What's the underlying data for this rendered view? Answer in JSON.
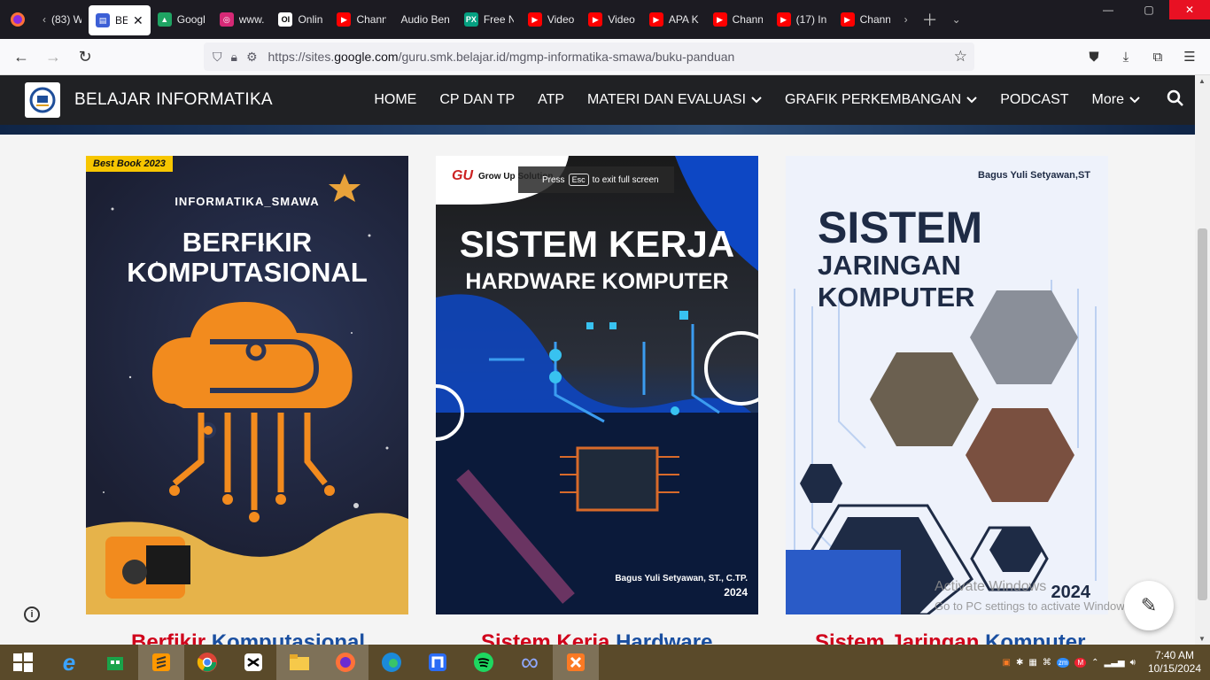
{
  "tabs": [
    {
      "label": "(83) W",
      "icon": "back-chevron-icon",
      "color": "#1c1b22"
    },
    {
      "label": "BEL",
      "icon": "google-sites-icon",
      "color": "#3c5fd6",
      "active": true
    },
    {
      "label": "Googl",
      "icon": "google-drive-icon",
      "color": "#f4b400"
    },
    {
      "label": "www.",
      "icon": "instagram-icon",
      "color": "#d62976"
    },
    {
      "label": "Onlin",
      "icon": "online-icon",
      "color": "#ffffff"
    },
    {
      "label": "Chann",
      "icon": "youtube-icon",
      "color": "#ff0000"
    },
    {
      "label": "Audio Ben",
      "icon": "none",
      "color": "#1c1b22"
    },
    {
      "label": "Free N",
      "icon": "pexels-icon",
      "color": "#05a081"
    },
    {
      "label": "Video",
      "icon": "youtube-icon",
      "color": "#ff0000"
    },
    {
      "label": "Video",
      "icon": "youtube-icon",
      "color": "#ff0000"
    },
    {
      "label": "APA K",
      "icon": "youtube-icon",
      "color": "#ff0000"
    },
    {
      "label": "Chann",
      "icon": "youtube-icon",
      "color": "#ff0000"
    },
    {
      "label": "(17) In",
      "icon": "youtube-icon",
      "color": "#ff0000"
    },
    {
      "label": "Chann",
      "icon": "youtube-icon",
      "color": "#ff0000"
    }
  ],
  "url": {
    "prefix": "https://sites.",
    "host": "google.com",
    "path": "/guru.smk.belajar.id/mgmp-informatika-smawa/buku-panduan"
  },
  "site": {
    "title": "BELAJAR INFORMATIKA",
    "menu": [
      {
        "label": "HOME",
        "dropdown": false
      },
      {
        "label": "CP DAN TP",
        "dropdown": false
      },
      {
        "label": "ATP",
        "dropdown": false
      },
      {
        "label": "MATERI DAN EVALUASI",
        "dropdown": true
      },
      {
        "label": "GRAFIK PERKEMBANGAN",
        "dropdown": true
      },
      {
        "label": "PODCAST",
        "dropdown": false
      },
      {
        "label": "More",
        "dropdown": true
      }
    ]
  },
  "books": [
    {
      "badge": "Best Book 2023",
      "author_top": "INFORMATIKA_SMAWA",
      "title_line1": "BERFIKIR",
      "title_line2": "KOMPUTASIONAL",
      "caption_red": "Berfikir",
      "caption_blue": "Komputasional"
    },
    {
      "publisher": "Grow Up Solution",
      "publisher_short": "GU",
      "title_line1": "SISTEM KERJA",
      "title_line2": "HARDWARE  KOMPUTER",
      "author_bottom": "Bagus Yuli Setyawan, ST., C.TP.",
      "year": "2024",
      "caption_red": "Sistem Kerja",
      "caption_blue": "Hardware"
    },
    {
      "author_top": "Bagus Yuli Setyawan,ST",
      "title_line1": "SISTEM",
      "title_line2": "JARINGAN KOMPUTER",
      "year": "2024",
      "caption_red": "Sistem Jaringan",
      "caption_blue": "Komputer"
    }
  ],
  "fullscreen": {
    "press": "Press",
    "key": "Esc",
    "rest": "to exit full screen"
  },
  "watermark": {
    "line1": "Activate Windows",
    "line2": "Go to PC settings to activate Windows."
  },
  "tray": {
    "time": "7:40 AM",
    "date": "10/15/2024"
  },
  "colors": {
    "header_bg": "#202124",
    "caption_red": "#d0021b",
    "caption_blue": "#1a4fa0",
    "taskbar": "#5a4a2a"
  }
}
